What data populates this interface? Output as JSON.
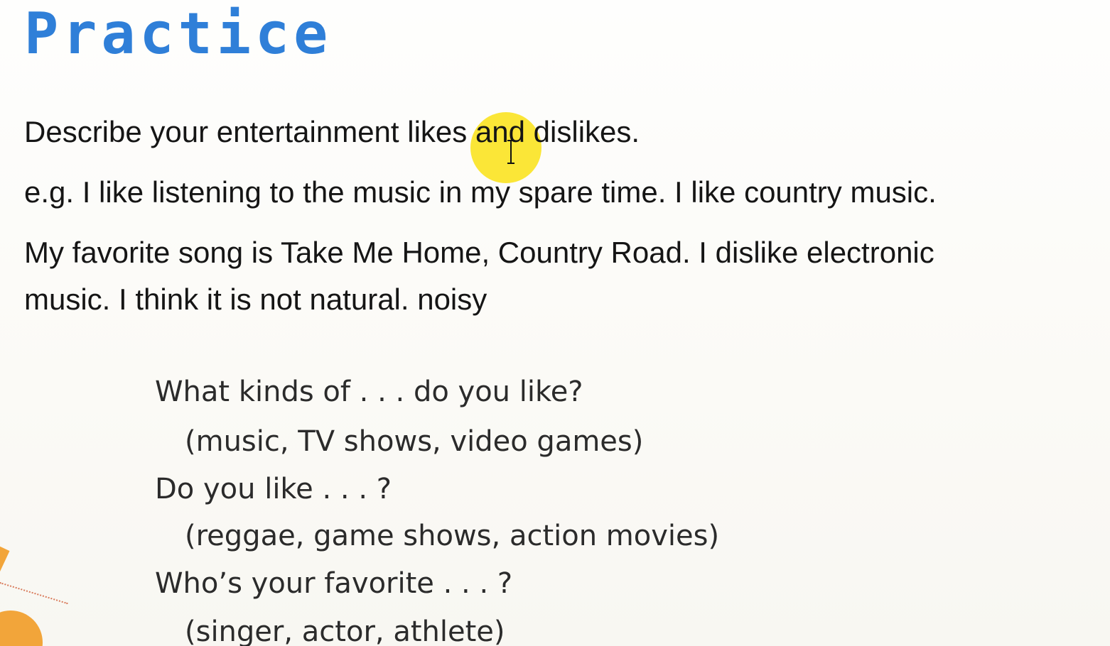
{
  "slide": {
    "title": "Practice",
    "lines": [
      "Describe your entertainment likes and dislikes.",
      "e.g. I like listening to the music in my spare time. I like country music.",
      "My favorite song is Take Me Home, Country Road. I dislike electronic",
      "music. I think it is not natural. noisy"
    ],
    "questions": [
      "What kinds of . . . do you like?",
      "(music, TV shows, video games)",
      "Do you like . . . ?",
      "(reggae, game shows, action movies)",
      "Who’s your favorite . . . ?",
      "(singer, actor, athlete)"
    ]
  },
  "colors": {
    "title": "#2f7fd8",
    "highlight": "#fae214",
    "accent_orange": "#f2a53a"
  },
  "icons": {
    "cursor": "text-cursor-icon"
  }
}
